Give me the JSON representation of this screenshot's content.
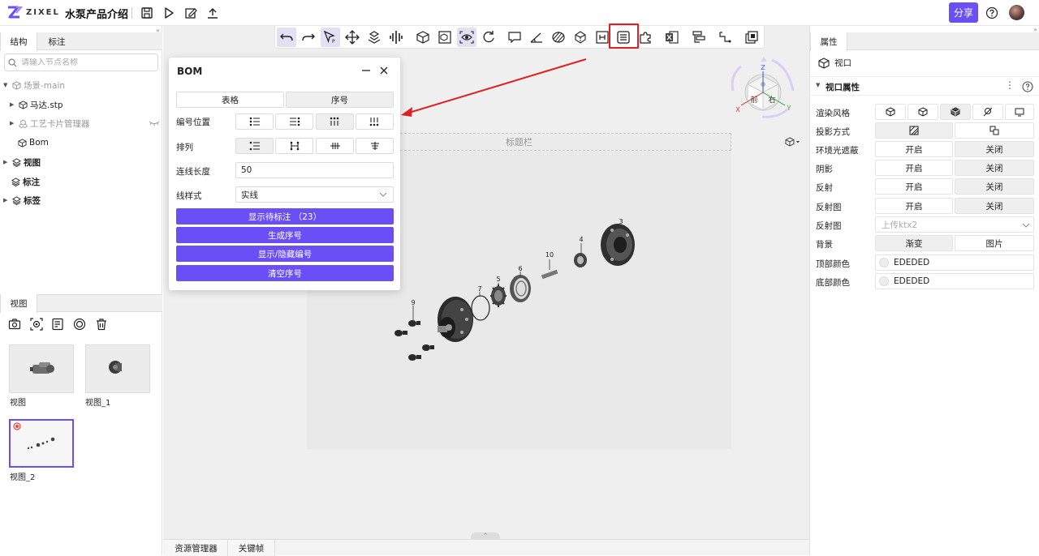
{
  "header": {
    "logo_text": "ZIXEL",
    "title": "水泵产品介绍",
    "share_label": "分享",
    "icons": [
      "save-icon",
      "play-icon",
      "edit-icon",
      "upload-icon"
    ]
  },
  "left_panel": {
    "tabs": [
      {
        "label": "结构"
      },
      {
        "label": "标注"
      }
    ],
    "search_placeholder": "请输入节点名称",
    "tree": [
      {
        "label": "场景-main",
        "dim": true,
        "expanded": true
      },
      {
        "label": "马达.stp",
        "dim": false
      },
      {
        "label": "工艺卡片管理器",
        "dim": true
      },
      {
        "label": "Bom",
        "dim": false
      },
      {
        "label": "视图",
        "bold": true
      },
      {
        "label": "标注",
        "bold": true
      },
      {
        "label": "标签",
        "bold": true
      }
    ],
    "views_tab": "视图",
    "view_tools": [
      "camera-icon",
      "screenshot-icon",
      "view-list-icon",
      "target-icon",
      "trash-icon"
    ],
    "thumbnails": [
      {
        "label": "视图"
      },
      {
        "label": "视图_1"
      },
      {
        "label": "视图_2",
        "selected": true
      }
    ]
  },
  "viewport": {
    "title_bar_label": "标题栏",
    "bottom_tabs": [
      {
        "label": "资源管理器"
      },
      {
        "label": "关键帧"
      }
    ],
    "balloon_numbers": [
      "3",
      "4",
      "10",
      "6",
      "5",
      "7",
      "9"
    ],
    "navcube": {
      "top": "Z",
      "front": "前",
      "right": "右",
      "axis_x": "X",
      "axis_y": "Y"
    }
  },
  "bom_dialog": {
    "title": "BOM",
    "mode_tabs": [
      {
        "label": "表格"
      },
      {
        "label": "序号"
      }
    ],
    "numbering_position_label": "编号位置",
    "arrangement_label": "排列",
    "line_length_label": "连线长度",
    "line_length_value": "50",
    "line_style_label": "线样式",
    "line_style_value": "实线",
    "actions": [
      {
        "label": "显示待标注 （23）"
      },
      {
        "label": "生成序号"
      },
      {
        "label": "显示/隐藏编号"
      },
      {
        "label": "清空序号"
      }
    ]
  },
  "right_panel": {
    "tab": "属性",
    "object_label": "视口",
    "section_title": "视口属性",
    "rows": [
      {
        "label": "渲染风格"
      },
      {
        "label": "投影方式"
      },
      {
        "label": "环境光遮蔽",
        "on": "开启",
        "off": "关闭"
      },
      {
        "label": "阴影",
        "on": "开启",
        "off": "关闭"
      },
      {
        "label": "反射",
        "on": "开启",
        "off": "关闭"
      },
      {
        "label": "反射图",
        "on": "开启",
        "off": "关闭"
      },
      {
        "label": "反射图",
        "select_placeholder": "上传ktx2"
      },
      {
        "label": "背景",
        "on": "渐变",
        "off": "图片"
      },
      {
        "label": "顶部颜色",
        "color": "EDEDED"
      },
      {
        "label": "底部颜色",
        "color": "EDEDED"
      }
    ]
  },
  "colors": {
    "accent": "#6b4ff6",
    "highlight": "#e02020",
    "annotation_arrow": "#e02020"
  }
}
